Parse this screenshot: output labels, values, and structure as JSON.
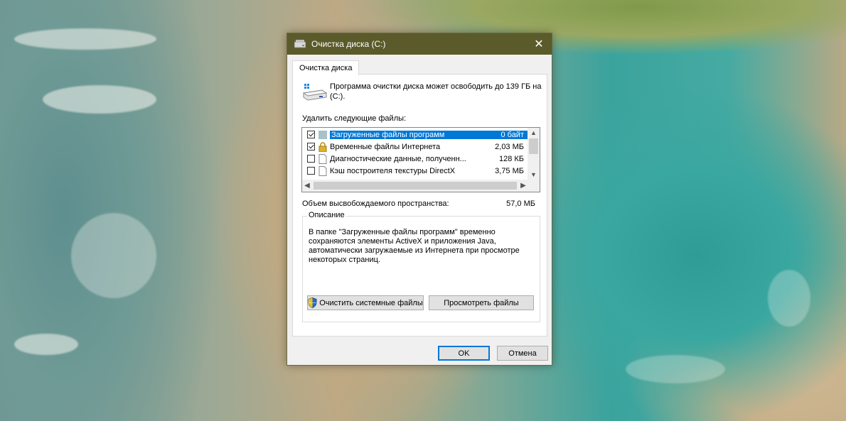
{
  "window": {
    "title": "Очистка диска  (C:)",
    "close_glyph": "✕"
  },
  "tab": {
    "label": "Очистка диска"
  },
  "info": {
    "text": "Программа очистки диска может освободить до 139 ГБ на  (C:).",
    "icon": "drive-icon"
  },
  "files": {
    "heading": "Удалить следующие файлы:",
    "items": [
      {
        "name": "Загруженные файлы программ",
        "size": "0 байт",
        "checked": true,
        "selected": true,
        "icon": "folder-icon"
      },
      {
        "name": "Временные файлы Интернета",
        "size": "2,03 МБ",
        "checked": true,
        "selected": false,
        "icon": "lock-icon"
      },
      {
        "name": "Диагностические данные, полученн...",
        "size": "128 КБ",
        "checked": false,
        "selected": false,
        "icon": "file-icon"
      },
      {
        "name": "Кэш построителя текстуры DirectX",
        "size": "3,75 МБ",
        "checked": false,
        "selected": false,
        "icon": "file-icon"
      }
    ]
  },
  "space": {
    "label": "Объем высвобождаемого пространства:",
    "value": "57,0 МБ"
  },
  "description": {
    "legend": "Описание",
    "text": "В папке \"Загруженные файлы программ\" временно сохраняются элементы ActiveX и приложения Java, автоматически загружаемые из Интернета при просмотре некоторых страниц."
  },
  "buttons": {
    "clean_system": "Очистить системные файлы",
    "view_files": "Просмотреть файлы",
    "ok": "OK",
    "cancel": "Отмена"
  },
  "colors": {
    "titlebar": "#5b5a2a",
    "selection": "#0078d7"
  }
}
